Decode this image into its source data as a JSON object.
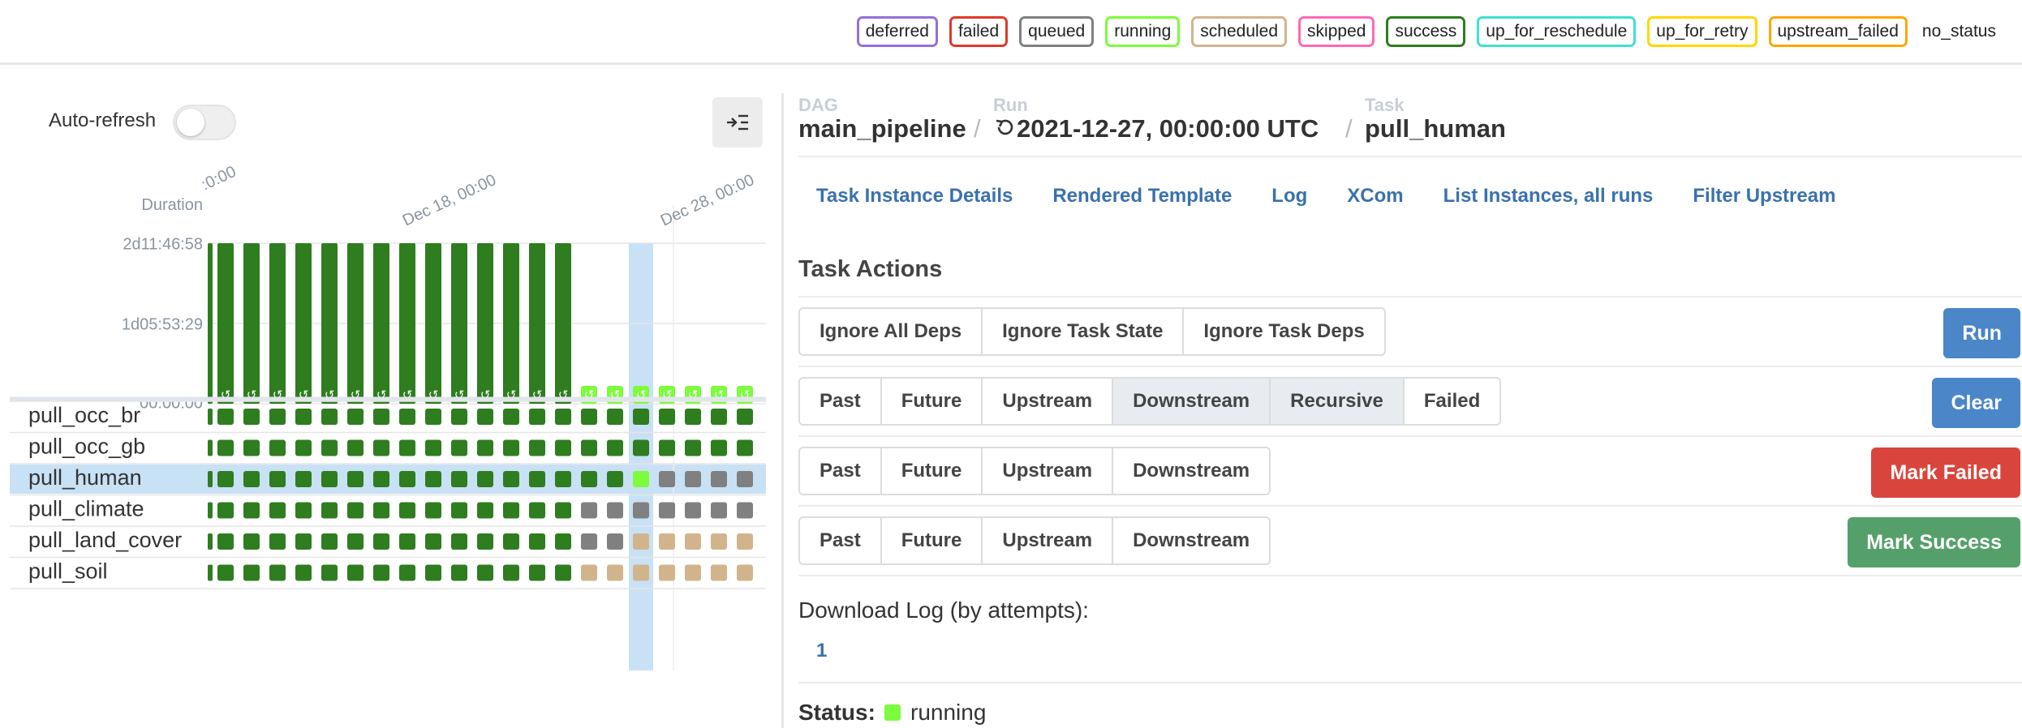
{
  "legend": {
    "items": [
      {
        "label": "deferred",
        "color": "#9370db"
      },
      {
        "label": "failed",
        "color": "#e0382a"
      },
      {
        "label": "queued",
        "color": "#808080"
      },
      {
        "label": "running",
        "color": "#7cfc3c"
      },
      {
        "label": "scheduled",
        "color": "#d2b48c"
      },
      {
        "label": "skipped",
        "color": "#ff69b4"
      },
      {
        "label": "success",
        "color": "#2e7d1f"
      },
      {
        "label": "up_for_reschedule",
        "color": "#40e0d0"
      },
      {
        "label": "up_for_retry",
        "color": "#ffd700"
      },
      {
        "label": "upstream_failed",
        "color": "#ffa500"
      }
    ],
    "no_status": "no_status"
  },
  "grid": {
    "auto_refresh_label": "Auto-refresh",
    "auto_refresh_on": false,
    "duration_label": "Duration",
    "date_labels": [
      ":0:00",
      "Dec 18, 00:00",
      "Dec 28, 00:00"
    ],
    "duration_ticks": [
      "2d11:46:58",
      "1d05:53:29",
      "00:00:00"
    ],
    "run_states": [
      "success",
      "success",
      "success",
      "success",
      "success",
      "success",
      "success",
      "success",
      "success",
      "success",
      "success",
      "success",
      "success",
      "success",
      "running",
      "running",
      "running",
      "running",
      "running",
      "running",
      "running"
    ],
    "duration_fractions": [
      1,
      1,
      1,
      1,
      1,
      1,
      1,
      1,
      1,
      1,
      1,
      1,
      1,
      1,
      0,
      0,
      0,
      0,
      0,
      0,
      0
    ],
    "selected_run_index": 16,
    "tasks": [
      {
        "name": "pull_occ_br",
        "states": [
          "success",
          "success",
          "success",
          "success",
          "success",
          "success",
          "success",
          "success",
          "success",
          "success",
          "success",
          "success",
          "success",
          "success",
          "success",
          "success",
          "success",
          "success",
          "success",
          "success",
          "success"
        ]
      },
      {
        "name": "pull_occ_gb",
        "states": [
          "success",
          "success",
          "success",
          "success",
          "success",
          "success",
          "success",
          "success",
          "success",
          "success",
          "success",
          "success",
          "success",
          "success",
          "success",
          "success",
          "success",
          "success",
          "success",
          "success",
          "success"
        ]
      },
      {
        "name": "pull_human",
        "states": [
          "success",
          "success",
          "success",
          "success",
          "success",
          "success",
          "success",
          "success",
          "success",
          "success",
          "success",
          "success",
          "success",
          "success",
          "success",
          "success",
          "running",
          "queued",
          "queued",
          "queued",
          "queued"
        ]
      },
      {
        "name": "pull_climate",
        "states": [
          "success",
          "success",
          "success",
          "success",
          "success",
          "success",
          "success",
          "success",
          "success",
          "success",
          "success",
          "success",
          "success",
          "success",
          "queued",
          "queued",
          "queued",
          "queued",
          "queued",
          "queued",
          "queued"
        ]
      },
      {
        "name": "pull_land_cover",
        "states": [
          "success",
          "success",
          "success",
          "success",
          "success",
          "success",
          "success",
          "success",
          "success",
          "success",
          "success",
          "success",
          "success",
          "success",
          "queued",
          "queued",
          "scheduled",
          "scheduled",
          "scheduled",
          "scheduled",
          "scheduled"
        ]
      },
      {
        "name": "pull_soil",
        "states": [
          "success",
          "success",
          "success",
          "success",
          "success",
          "success",
          "success",
          "success",
          "success",
          "success",
          "success",
          "success",
          "success",
          "success",
          "scheduled",
          "scheduled",
          "scheduled",
          "scheduled",
          "scheduled",
          "scheduled",
          "scheduled"
        ]
      }
    ],
    "selected_task_index": 2,
    "colors": {
      "success": "#2e7d1f",
      "running": "#7cfc3c",
      "queued": "#808080",
      "scheduled": "#d2b48c",
      "selected": "#c8e1f5"
    }
  },
  "breadcrumb": {
    "dag_label": "DAG",
    "dag_value": "main_pipeline",
    "run_label": "Run",
    "run_value": "2021-12-27, 00:00:00 UTC",
    "task_label": "Task",
    "task_value": "pull_human"
  },
  "tabs": [
    "Task Instance Details",
    "Rendered Template",
    "Log",
    "XCom",
    "List Instances, all runs",
    "Filter Upstream"
  ],
  "task_actions": {
    "title": "Task Actions",
    "run_options": [
      "Ignore All Deps",
      "Ignore Task State",
      "Ignore Task Deps"
    ],
    "run_button": "Run",
    "clear_options": [
      "Past",
      "Future",
      "Upstream",
      "Downstream",
      "Recursive",
      "Failed"
    ],
    "clear_button": "Clear",
    "failed_options": [
      "Past",
      "Future",
      "Upstream",
      "Downstream"
    ],
    "failed_button": "Mark Failed",
    "success_options": [
      "Past",
      "Future",
      "Upstream",
      "Downstream"
    ],
    "success_button": "Mark Success",
    "button_colors": {
      "run": "#4a86c8",
      "clear": "#4a86c8",
      "failed": "#d9453d",
      "success": "#55a06a"
    }
  },
  "download": {
    "label": "Download Log (by attempts):",
    "attempt": "1"
  },
  "status": {
    "label": "Status:",
    "value": "running",
    "color": "#7cfc3c"
  }
}
